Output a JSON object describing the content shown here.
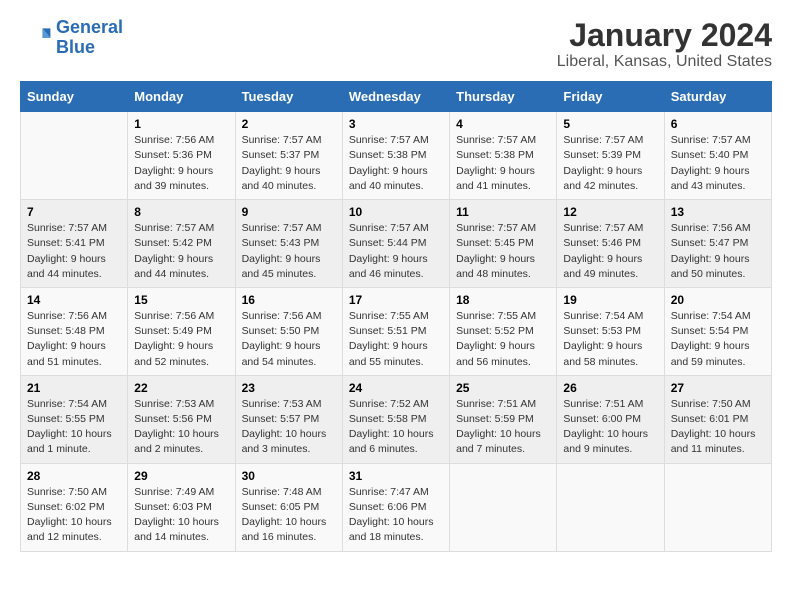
{
  "logo": {
    "text_general": "General",
    "text_blue": "Blue"
  },
  "title": "January 2024",
  "subtitle": "Liberal, Kansas, United States",
  "header": {
    "days": [
      "Sunday",
      "Monday",
      "Tuesday",
      "Wednesday",
      "Thursday",
      "Friday",
      "Saturday"
    ]
  },
  "weeks": [
    [
      {
        "day": "",
        "info": ""
      },
      {
        "day": "1",
        "info": "Sunrise: 7:56 AM\nSunset: 5:36 PM\nDaylight: 9 hours\nand 39 minutes."
      },
      {
        "day": "2",
        "info": "Sunrise: 7:57 AM\nSunset: 5:37 PM\nDaylight: 9 hours\nand 40 minutes."
      },
      {
        "day": "3",
        "info": "Sunrise: 7:57 AM\nSunset: 5:38 PM\nDaylight: 9 hours\nand 40 minutes."
      },
      {
        "day": "4",
        "info": "Sunrise: 7:57 AM\nSunset: 5:38 PM\nDaylight: 9 hours\nand 41 minutes."
      },
      {
        "day": "5",
        "info": "Sunrise: 7:57 AM\nSunset: 5:39 PM\nDaylight: 9 hours\nand 42 minutes."
      },
      {
        "day": "6",
        "info": "Sunrise: 7:57 AM\nSunset: 5:40 PM\nDaylight: 9 hours\nand 43 minutes."
      }
    ],
    [
      {
        "day": "7",
        "info": "Sunrise: 7:57 AM\nSunset: 5:41 PM\nDaylight: 9 hours\nand 44 minutes."
      },
      {
        "day": "8",
        "info": "Sunrise: 7:57 AM\nSunset: 5:42 PM\nDaylight: 9 hours\nand 44 minutes."
      },
      {
        "day": "9",
        "info": "Sunrise: 7:57 AM\nSunset: 5:43 PM\nDaylight: 9 hours\nand 45 minutes."
      },
      {
        "day": "10",
        "info": "Sunrise: 7:57 AM\nSunset: 5:44 PM\nDaylight: 9 hours\nand 46 minutes."
      },
      {
        "day": "11",
        "info": "Sunrise: 7:57 AM\nSunset: 5:45 PM\nDaylight: 9 hours\nand 48 minutes."
      },
      {
        "day": "12",
        "info": "Sunrise: 7:57 AM\nSunset: 5:46 PM\nDaylight: 9 hours\nand 49 minutes."
      },
      {
        "day": "13",
        "info": "Sunrise: 7:56 AM\nSunset: 5:47 PM\nDaylight: 9 hours\nand 50 minutes."
      }
    ],
    [
      {
        "day": "14",
        "info": "Sunrise: 7:56 AM\nSunset: 5:48 PM\nDaylight: 9 hours\nand 51 minutes."
      },
      {
        "day": "15",
        "info": "Sunrise: 7:56 AM\nSunset: 5:49 PM\nDaylight: 9 hours\nand 52 minutes."
      },
      {
        "day": "16",
        "info": "Sunrise: 7:56 AM\nSunset: 5:50 PM\nDaylight: 9 hours\nand 54 minutes."
      },
      {
        "day": "17",
        "info": "Sunrise: 7:55 AM\nSunset: 5:51 PM\nDaylight: 9 hours\nand 55 minutes."
      },
      {
        "day": "18",
        "info": "Sunrise: 7:55 AM\nSunset: 5:52 PM\nDaylight: 9 hours\nand 56 minutes."
      },
      {
        "day": "19",
        "info": "Sunrise: 7:54 AM\nSunset: 5:53 PM\nDaylight: 9 hours\nand 58 minutes."
      },
      {
        "day": "20",
        "info": "Sunrise: 7:54 AM\nSunset: 5:54 PM\nDaylight: 9 hours\nand 59 minutes."
      }
    ],
    [
      {
        "day": "21",
        "info": "Sunrise: 7:54 AM\nSunset: 5:55 PM\nDaylight: 10 hours\nand 1 minute."
      },
      {
        "day": "22",
        "info": "Sunrise: 7:53 AM\nSunset: 5:56 PM\nDaylight: 10 hours\nand 2 minutes."
      },
      {
        "day": "23",
        "info": "Sunrise: 7:53 AM\nSunset: 5:57 PM\nDaylight: 10 hours\nand 3 minutes."
      },
      {
        "day": "24",
        "info": "Sunrise: 7:52 AM\nSunset: 5:58 PM\nDaylight: 10 hours\nand 6 minutes."
      },
      {
        "day": "25",
        "info": "Sunrise: 7:51 AM\nSunset: 5:59 PM\nDaylight: 10 hours\nand 7 minutes."
      },
      {
        "day": "26",
        "info": "Sunrise: 7:51 AM\nSunset: 6:00 PM\nDaylight: 10 hours\nand 9 minutes."
      },
      {
        "day": "27",
        "info": "Sunrise: 7:50 AM\nSunset: 6:01 PM\nDaylight: 10 hours\nand 11 minutes."
      }
    ],
    [
      {
        "day": "28",
        "info": "Sunrise: 7:50 AM\nSunset: 6:02 PM\nDaylight: 10 hours\nand 12 minutes."
      },
      {
        "day": "29",
        "info": "Sunrise: 7:49 AM\nSunset: 6:03 PM\nDaylight: 10 hours\nand 14 minutes."
      },
      {
        "day": "30",
        "info": "Sunrise: 7:48 AM\nSunset: 6:05 PM\nDaylight: 10 hours\nand 16 minutes."
      },
      {
        "day": "31",
        "info": "Sunrise: 7:47 AM\nSunset: 6:06 PM\nDaylight: 10 hours\nand 18 minutes."
      },
      {
        "day": "",
        "info": ""
      },
      {
        "day": "",
        "info": ""
      },
      {
        "day": "",
        "info": ""
      }
    ]
  ]
}
